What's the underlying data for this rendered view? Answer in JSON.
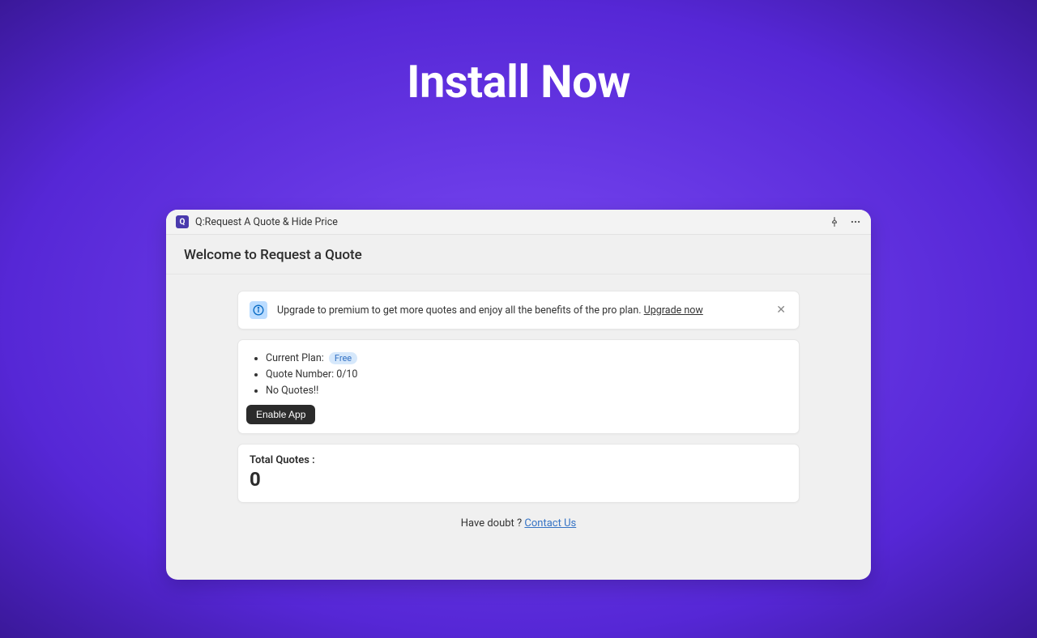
{
  "hero": {
    "title": "Install Now"
  },
  "app": {
    "icon_letter": "Q",
    "name": "Q:Request A Quote & Hide Price"
  },
  "welcome": "Welcome to Request a Quote",
  "upgrade": {
    "text": "Upgrade to premium to get more quotes and enjoy all the benefits of the pro plan. ",
    "link": "Upgrade now"
  },
  "plan": {
    "current_label": "Current Plan:",
    "badge": "Free",
    "quote_number": "Quote Number: 0/10",
    "no_quotes": "No Quotes!!",
    "enable_label": "Enable App"
  },
  "total": {
    "label": "Total Quotes :",
    "value": "0"
  },
  "contact": {
    "prefix": "Have doubt ? ",
    "link": "Contact Us"
  }
}
